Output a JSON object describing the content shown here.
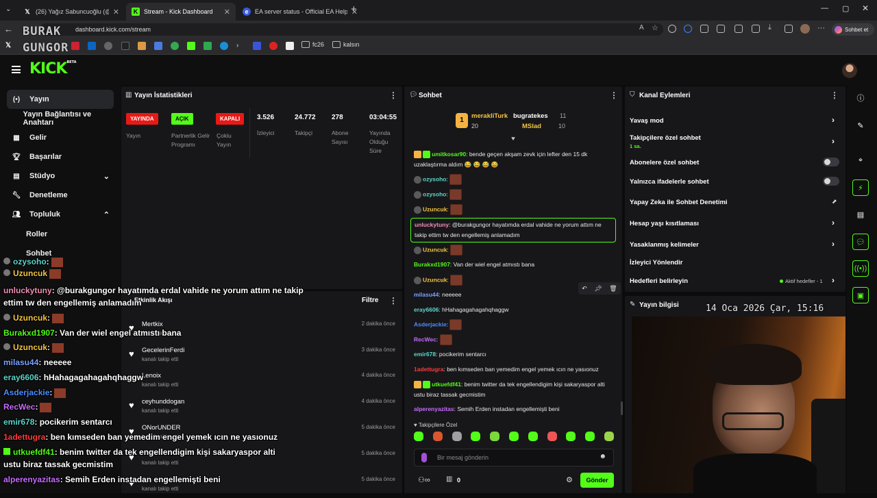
{
  "browser": {
    "tabs": [
      {
        "label": "(26) Yağız Sabuncuoğlu (@yagosa",
        "icon": "x-logo-icon"
      },
      {
        "label": "Stream - Kick Dashboard",
        "icon": "kick-favicon-icon"
      },
      {
        "label": "EA server status - Official EA Help",
        "icon": "ea-favicon-icon"
      }
    ],
    "url": "dashboard.kick.com/stream",
    "profile_label": "Sohbet et",
    "bookmarks": [
      {
        "label": "fc26"
      },
      {
        "label": "kalsın"
      }
    ]
  },
  "watermark": {
    "line1": "BURAK",
    "line2": "GUNGOR"
  },
  "kick": {
    "logo": "KICK",
    "beta": "BETA"
  },
  "sidebar": {
    "items": [
      {
        "label": "Yayın",
        "icon": "broadcast-icon"
      },
      {
        "label": "Yayın Bağlantısı ve Anahtarı",
        "icon": ""
      },
      {
        "label": "Gelir",
        "icon": "grid-icon"
      },
      {
        "label": "Başarılar",
        "icon": "trophy-icon"
      },
      {
        "label": "Stüdyo",
        "icon": "layers-icon"
      },
      {
        "label": "Denetleme",
        "icon": "wrench-icon"
      },
      {
        "label": "Topluluk",
        "icon": "people-icon"
      },
      {
        "label": "Roller",
        "icon": ""
      },
      {
        "label": "Sohbet",
        "icon": ""
      }
    ]
  },
  "stats": {
    "title": "Yayın İstatistikleri",
    "items": [
      {
        "badge": "YAYINDA",
        "label": "Yayın",
        "badge_color": "#e91916"
      },
      {
        "badge": "AÇIK",
        "label": "Partnerlik Gelir Programı",
        "badge_color": "#53fc18"
      },
      {
        "badge": "KAPALI",
        "label": "Çoklu Yayın",
        "badge_color": "#e91916"
      },
      {
        "value": "3.526",
        "label": "İzleyici"
      },
      {
        "value": "24.772",
        "label": "Takipçi"
      },
      {
        "value": "278",
        "label": "Abone Sayısı"
      },
      {
        "value": "03:04:55",
        "label": "Yayında Olduğu Süre"
      }
    ]
  },
  "activity": {
    "title": "Etkinlik Akışı",
    "filter": "Filtre",
    "rows": [
      {
        "name": "Mertkix",
        "sub": "kanalı takip etti",
        "time": "2 dakika önce"
      },
      {
        "name": "GecelerinFerdi",
        "sub": "kanalı takip etti",
        "time": "3 dakika önce"
      },
      {
        "name": "Lenoix",
        "sub": "kanalı takip etti",
        "time": "4 dakika önce"
      },
      {
        "name": "ceyhunddogan",
        "sub": "kanalı takip etti",
        "time": "4 dakika önce"
      },
      {
        "name": "ONorUNDER",
        "sub": "kanalı takip etti",
        "time": "5 dakika önce"
      },
      {
        "name": "",
        "sub": "kanalı takip etti",
        "time": "5 dakika önce"
      },
      {
        "name": "",
        "sub": "kanalı takip etti",
        "time": "5 dakika önce"
      }
    ]
  },
  "chat": {
    "title": "Sohbet",
    "leaders": [
      {
        "rank": "1",
        "name": "merakliTurk",
        "count": "20"
      },
      {
        "name": "bugratekes",
        "count": "11"
      },
      {
        "name": "MSlad",
        "count": "10"
      }
    ],
    "messages": [
      {
        "user": "umitkosar90",
        "color": "#53fc18",
        "text": ": bende geçen akşam zevk için lefter den 15 dk uzaklaştırma aldım 😂 😂 😂 😂"
      },
      {
        "user": "ozysoho",
        "color": "#5bd6c9",
        "text": ":"
      },
      {
        "user": "ozysoho",
        "color": "#5bd6c9",
        "text": ":"
      },
      {
        "user": "Uzuncuk",
        "color": "#f5c542",
        "text": ":"
      },
      {
        "user": "unluckytuny",
        "color": "#f08fb4",
        "text": ": @burakgungor hayatımda erdal vahide ne yorum attım ne takip ettim tw den engellemiş anlamadım"
      },
      {
        "user": "Uzuncuk",
        "color": "#f5c542",
        "text": ":"
      },
      {
        "user": "Burakxd1907",
        "color": "#53fc18",
        "text": ": Van der wiel engel atmıstı bana"
      },
      {
        "user": "Uzuncuk",
        "color": "#f5c542",
        "text": ":"
      },
      {
        "user": "milasu44",
        "color": "#7aa0ff",
        "text": ": neeeee"
      },
      {
        "user": "eray6606",
        "color": "#5bd6c9",
        "text": ": hHahagagahagahqhaggw"
      },
      {
        "user": "Asderjackie",
        "color": "#4e8cff",
        "text": ":"
      },
      {
        "user": "RecWec",
        "color": "#c86bff",
        "text": ":"
      },
      {
        "user": "emir678",
        "color": "#5bd6c9",
        "text": ": pocikerim sentarcı"
      },
      {
        "user": "1adettugra",
        "color": "#ff3b3b",
        "text": ": ben kımseden ban yemedim engel yemek ıcın ne yasıonuz"
      },
      {
        "user": "utkuefdf41",
        "color": "#53fc18",
        "text": ": benim twitter da tek engellendigim kişi sakaryaspor alti ustu biraz tassak gecmistim"
      },
      {
        "user": "alperenyazitas",
        "color": "#c86bff",
        "text": ": Semih Erden instadan engellemişti beni"
      }
    ],
    "followers_only": "Takipçilere Özel",
    "input_placeholder": "Bir mesaj gönderin",
    "count": "0",
    "send": "Gönder"
  },
  "actions": {
    "title": "Kanal Eylemleri",
    "items": [
      {
        "label": "Yavaş mod"
      },
      {
        "label": "Takipçilere özel sohbet",
        "sub": "1 sa."
      },
      {
        "label": "Abonelere özel sohbet"
      },
      {
        "label": "Yalnızca ifadelerle sohbet"
      },
      {
        "label": "Yapay Zeka ile Sohbet Denetimi"
      },
      {
        "label": "Hesap yaşı kısıtlaması"
      },
      {
        "label": "Yasaklanmış kelimeler"
      },
      {
        "label": "İzleyici Yönlendir"
      },
      {
        "label": "Hedefleri belirleyin",
        "status": "Aktif hedefler - 1"
      }
    ]
  },
  "streaminfo": {
    "title": "Yayın bilgisi",
    "clock": "14 Oca 2026 Çar, 15:16"
  },
  "overlay": {
    "messages": [
      {
        "user": "ozysoho",
        "color": "#5bd6c9",
        "text": ":"
      },
      {
        "user": "Uzuncuk",
        "color": "#f5c542",
        "text": ""
      },
      {
        "user": "unluckytuny",
        "color": "#f08fb4",
        "text": ": @burakgungor hayatımda erdal vahide ne yorum attım ne takip"
      },
      {
        "user": "",
        "color": "#fff",
        "text": "ettim tw den engellemiş anlamadım"
      },
      {
        "user": "Uzuncuk",
        "color": "#f5c542",
        "text": ":"
      },
      {
        "user": "Burakxd1907",
        "color": "#53fc18",
        "text": ": Van der wiel engel atmıstı bana"
      },
      {
        "user": "Uzuncuk",
        "color": "#f5c542",
        "text": ":"
      },
      {
        "user": "milasu44",
        "color": "#7aa0ff",
        "text": ": neeeee"
      },
      {
        "user": "eray6606",
        "color": "#5bd6c9",
        "text": ": hHahagagahagahqhaggw"
      },
      {
        "user": "Asderjackie",
        "color": "#4e8cff",
        "text": ":"
      },
      {
        "user": "RecWec",
        "color": "#c86bff",
        "text": ":"
      },
      {
        "user": "emir678",
        "color": "#5bd6c9",
        "text": ": pocikerim sentarcı"
      },
      {
        "user": "1adettugra",
        "color": "#ff3b3b",
        "text": ": ben kımseden ban yemedim engel yemek ıcın ne yasıonuz"
      },
      {
        "user": "utkuefdf41",
        "color": "#53fc18",
        "text": ": benim twitter da tek engellendigim kişi sakaryaspor alti"
      },
      {
        "user": "",
        "color": "#fff",
        "text": "ustu biraz tassak gecmistim"
      },
      {
        "user": "alperenyazitas",
        "color": "#c86bff",
        "text": ": Semih Erden instadan engellemişti beni"
      }
    ]
  }
}
